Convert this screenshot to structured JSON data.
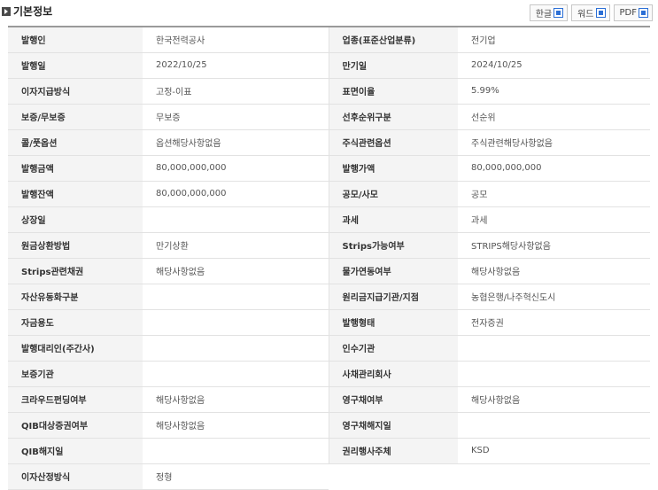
{
  "header": {
    "title": "기본정보",
    "buttons": [
      {
        "label": "한글",
        "icon": "hwp-icon"
      },
      {
        "label": "워드",
        "icon": "word-icon"
      },
      {
        "label": "PDF",
        "icon": "pdf-icon"
      }
    ]
  },
  "rows": [
    [
      {
        "label": "발행인",
        "value": "한국전력공사"
      },
      {
        "label": "업종(표준산업분류)",
        "value": "전기업"
      }
    ],
    [
      {
        "label": "발행일",
        "value": "2022/10/25"
      },
      {
        "label": "만기일",
        "value": "2024/10/25"
      }
    ],
    [
      {
        "label": "이자지급방식",
        "value": "고정-이표"
      },
      {
        "label": "표면이율",
        "value": "5.99%"
      }
    ],
    [
      {
        "label": "보증/무보증",
        "value": "무보증"
      },
      {
        "label": "선후순위구분",
        "value": "선순위"
      }
    ],
    [
      {
        "label": "콜/풋옵션",
        "value": "옵션해당사항없음"
      },
      {
        "label": "주식관련옵션",
        "value": "주식관련해당사항없음"
      }
    ],
    [
      {
        "label": "발행금액",
        "value": "80,000,000,000"
      },
      {
        "label": "발행가액",
        "value": "80,000,000,000"
      }
    ],
    [
      {
        "label": "발행잔액",
        "value": "80,000,000,000"
      },
      {
        "label": "공모/사모",
        "value": "공모"
      }
    ],
    [
      {
        "label": "상장일",
        "value": ""
      },
      {
        "label": "과세",
        "value": "과세"
      }
    ],
    [
      {
        "label": "원금상환방법",
        "value": "만기상환"
      },
      {
        "label": "Strips가능여부",
        "value": "STRIPS해당사항없음"
      }
    ],
    [
      {
        "label": "Strips관련채권",
        "value": "해당사항없음"
      },
      {
        "label": "물가연동여부",
        "value": "해당사항없음"
      }
    ],
    [
      {
        "label": "자산유동화구분",
        "value": ""
      },
      {
        "label": "원리금지급기관/지점",
        "value": "농협은행/나주혁신도시"
      }
    ],
    [
      {
        "label": "자금용도",
        "value": ""
      },
      {
        "label": "발행형태",
        "value": "전자증권"
      }
    ],
    [
      {
        "label": "발행대리인(주간사)",
        "value": ""
      },
      {
        "label": "인수기관",
        "value": ""
      }
    ],
    [
      {
        "label": "보증기관",
        "value": ""
      },
      {
        "label": "사채관리회사",
        "value": ""
      }
    ],
    [
      {
        "label": "크라우드펀딩여부",
        "value": "해당사항없음"
      },
      {
        "label": "영구채여부",
        "value": "해당사항없음"
      }
    ],
    [
      {
        "label": "QIB대상증권여부",
        "value": "해당사항없음"
      },
      {
        "label": "영구채해지일",
        "value": ""
      }
    ],
    [
      {
        "label": "QIB해지일",
        "value": ""
      },
      {
        "label": "권리행사주체",
        "value": "KSD"
      }
    ],
    [
      {
        "label": "이자산정방식",
        "value": "정형"
      },
      {
        "label": "",
        "value": ""
      }
    ]
  ]
}
